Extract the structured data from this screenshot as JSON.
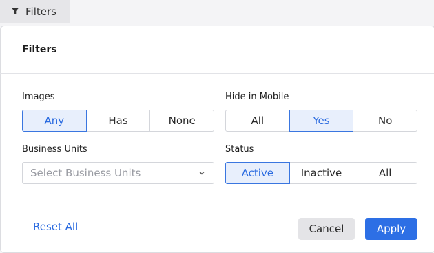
{
  "toolbar": {
    "filters_tab_label": "Filters",
    "filters_icon": "filter-funnel-icon"
  },
  "panel": {
    "title": "Filters",
    "images": {
      "label": "Images",
      "options": [
        "Any",
        "Has",
        "None"
      ],
      "selected": "Any"
    },
    "hide_in_mobile": {
      "label": "Hide in Mobile",
      "options": [
        "All",
        "Yes",
        "No"
      ],
      "selected": "Yes"
    },
    "business_units": {
      "label": "Business Units",
      "placeholder": "Select Business Units",
      "icon": "chevron-down-icon"
    },
    "status": {
      "label": "Status",
      "options": [
        "Active",
        "Inactive",
        "All"
      ],
      "selected": "Active"
    }
  },
  "footer": {
    "reset_label": "Reset All",
    "cancel_label": "Cancel",
    "apply_label": "Apply"
  },
  "colors": {
    "accent": "#2d6fe5",
    "active_bg": "#e8effc",
    "border": "#d4d6db"
  }
}
